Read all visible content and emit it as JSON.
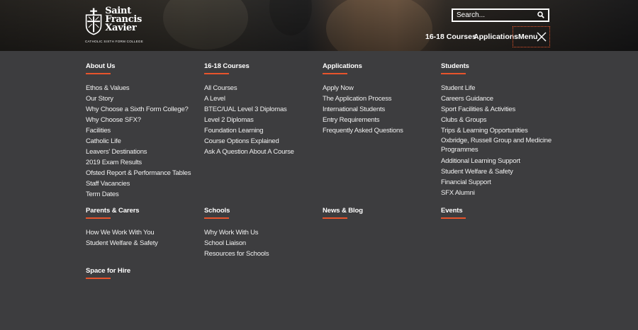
{
  "logo": {
    "line1": "Saint",
    "line2": "Francis",
    "line3": "Xavier",
    "subtitle": "CATHOLIC SIXTH FORM COLLEGE"
  },
  "search": {
    "placeholder": "Search..."
  },
  "nav": {
    "courses": "16-18 Courses",
    "applications": "Applications",
    "menu": "Menu"
  },
  "colors": {
    "accent": "#e8542c",
    "panel": "#3d3d3f"
  },
  "menu": {
    "about": {
      "heading": "About Us",
      "items": [
        "Ethos & Values",
        "Our Story",
        "Why Choose a Sixth Form College?",
        "Why Choose SFX?",
        "Facilities",
        "Catholic Life",
        "Leavers' Destinations",
        "2019 Exam Results",
        "Ofsted Report & Performance Tables",
        "Staff Vacancies",
        "Term Dates"
      ]
    },
    "courses": {
      "heading": "16-18 Courses",
      "items": [
        "All Courses",
        "A Level",
        "BTEC/UAL Level 3 Diplomas",
        "Level 2 Diplomas",
        "Foundation Learning",
        "Course Options Explained",
        "Ask A Question About A Course"
      ]
    },
    "applications": {
      "heading": "Applications",
      "items": [
        "Apply Now",
        "The Application Process",
        "International Students",
        "Entry Requirements",
        "Frequently Asked Questions"
      ]
    },
    "students": {
      "heading": "Students",
      "items": [
        "Student Life",
        "Careers Guidance",
        "Sport Facilities & Activities",
        "Clubs & Groups",
        "Trips & Learning Opportunities",
        "Oxbridge, Russell Group and Medicine Programmes",
        "Additional Learning Support",
        "Student Welfare & Safety",
        "Financial Support",
        "SFX Alumni"
      ]
    },
    "parents": {
      "heading": "Parents & Carers",
      "items": [
        "How We Work With You",
        "Student Welfare & Safety"
      ]
    },
    "schools": {
      "heading": "Schools",
      "items": [
        "Why Work With Us",
        "School Liaison",
        "Resources for Schools"
      ]
    },
    "news": {
      "heading": "News & Blog"
    },
    "events": {
      "heading": "Events"
    },
    "space": {
      "heading": "Space for Hire"
    }
  }
}
